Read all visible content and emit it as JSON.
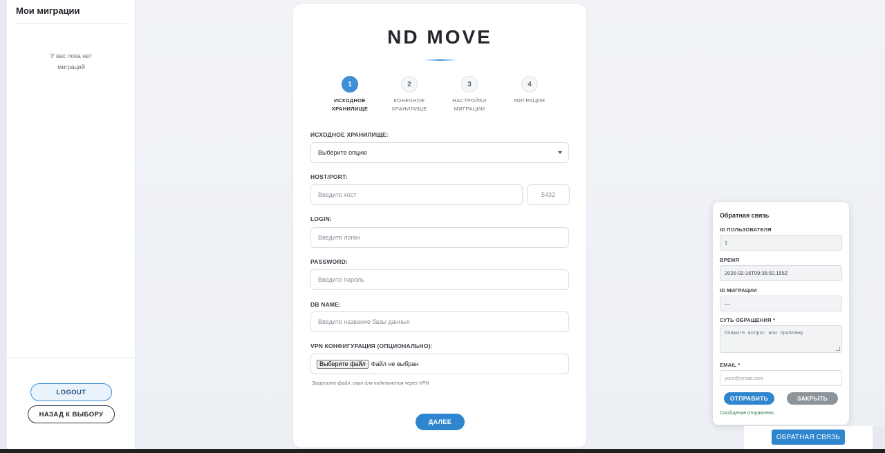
{
  "sidebar": {
    "title": "Мои миграции",
    "empty_line1": "У вас пока нет",
    "empty_line2": "миграций",
    "logout_label": "LOGOUT",
    "back_label": "НАЗАД К ВЫБОРУ"
  },
  "logo": {
    "text": "ND MOVE"
  },
  "steps": [
    {
      "num": "1",
      "line1": "ИСХОДНОЕ",
      "line2": "ХРАНИЛИЩЕ",
      "active": true
    },
    {
      "num": "2",
      "line1": "КОНЕЧНОЕ",
      "line2": "ХРАНИЛИЩЕ",
      "active": false
    },
    {
      "num": "3",
      "line1": "НАСТРОЙКИ",
      "line2": "МИГРАЦИИ",
      "active": false
    },
    {
      "num": "4",
      "line1": "МИГРАЦИЯ",
      "line2": "",
      "active": false
    }
  ],
  "form": {
    "source_label": "ИСХОДНОЕ ХРАНИЛИЩЕ:",
    "source_value": "Выберите опцию",
    "host_label": "HOST/PORT:",
    "host_placeholder": "Введите хост",
    "port_placeholder": "5432",
    "login_label": "LOGIN:",
    "login_placeholder": "Введите логин",
    "password_label": "PASSWORD:",
    "password_placeholder": "Введите пароль",
    "dbname_label": "DB NAME:",
    "dbname_placeholder": "Введите название базы данных",
    "vpn_label": "VPN КОНФИГУРАЦИЯ (ОПЦИОНАЛЬНО):",
    "file_button": "Выберите файл",
    "file_none": "Файл не выбран",
    "vpn_hint": "Загрузите файл .ovpn для подключения через VPN",
    "next_label": "ДАЛЕЕ"
  },
  "feedback": {
    "title": "Обратная связь",
    "user_id_label": "ID ПОЛЬЗОВАТЕЛЯ",
    "user_id_value": "1",
    "time_label": "ВРЕМЯ",
    "time_value": "2026-02-16T09:36:50.155Z",
    "migration_id_label": "ID МИГРАЦИИ",
    "migration_id_value": "—",
    "subject_label": "СУТЬ ОБРАЩЕНИЯ *",
    "subject_placeholder": "Опишите вопрос или проблему",
    "email_label": "EMAIL *",
    "email_placeholder": "your@email.com",
    "send_label": "ОТПРАВИТЬ",
    "close_label": "ЗАКРЫТЬ",
    "status": "Сообщение отправлено.",
    "tab_label": "ОБРАТНАЯ СВЯЗЬ"
  },
  "colors": {
    "accent": "#2f86cf",
    "step_active": "#3d8fd6",
    "success_text": "#2e7d4a"
  }
}
